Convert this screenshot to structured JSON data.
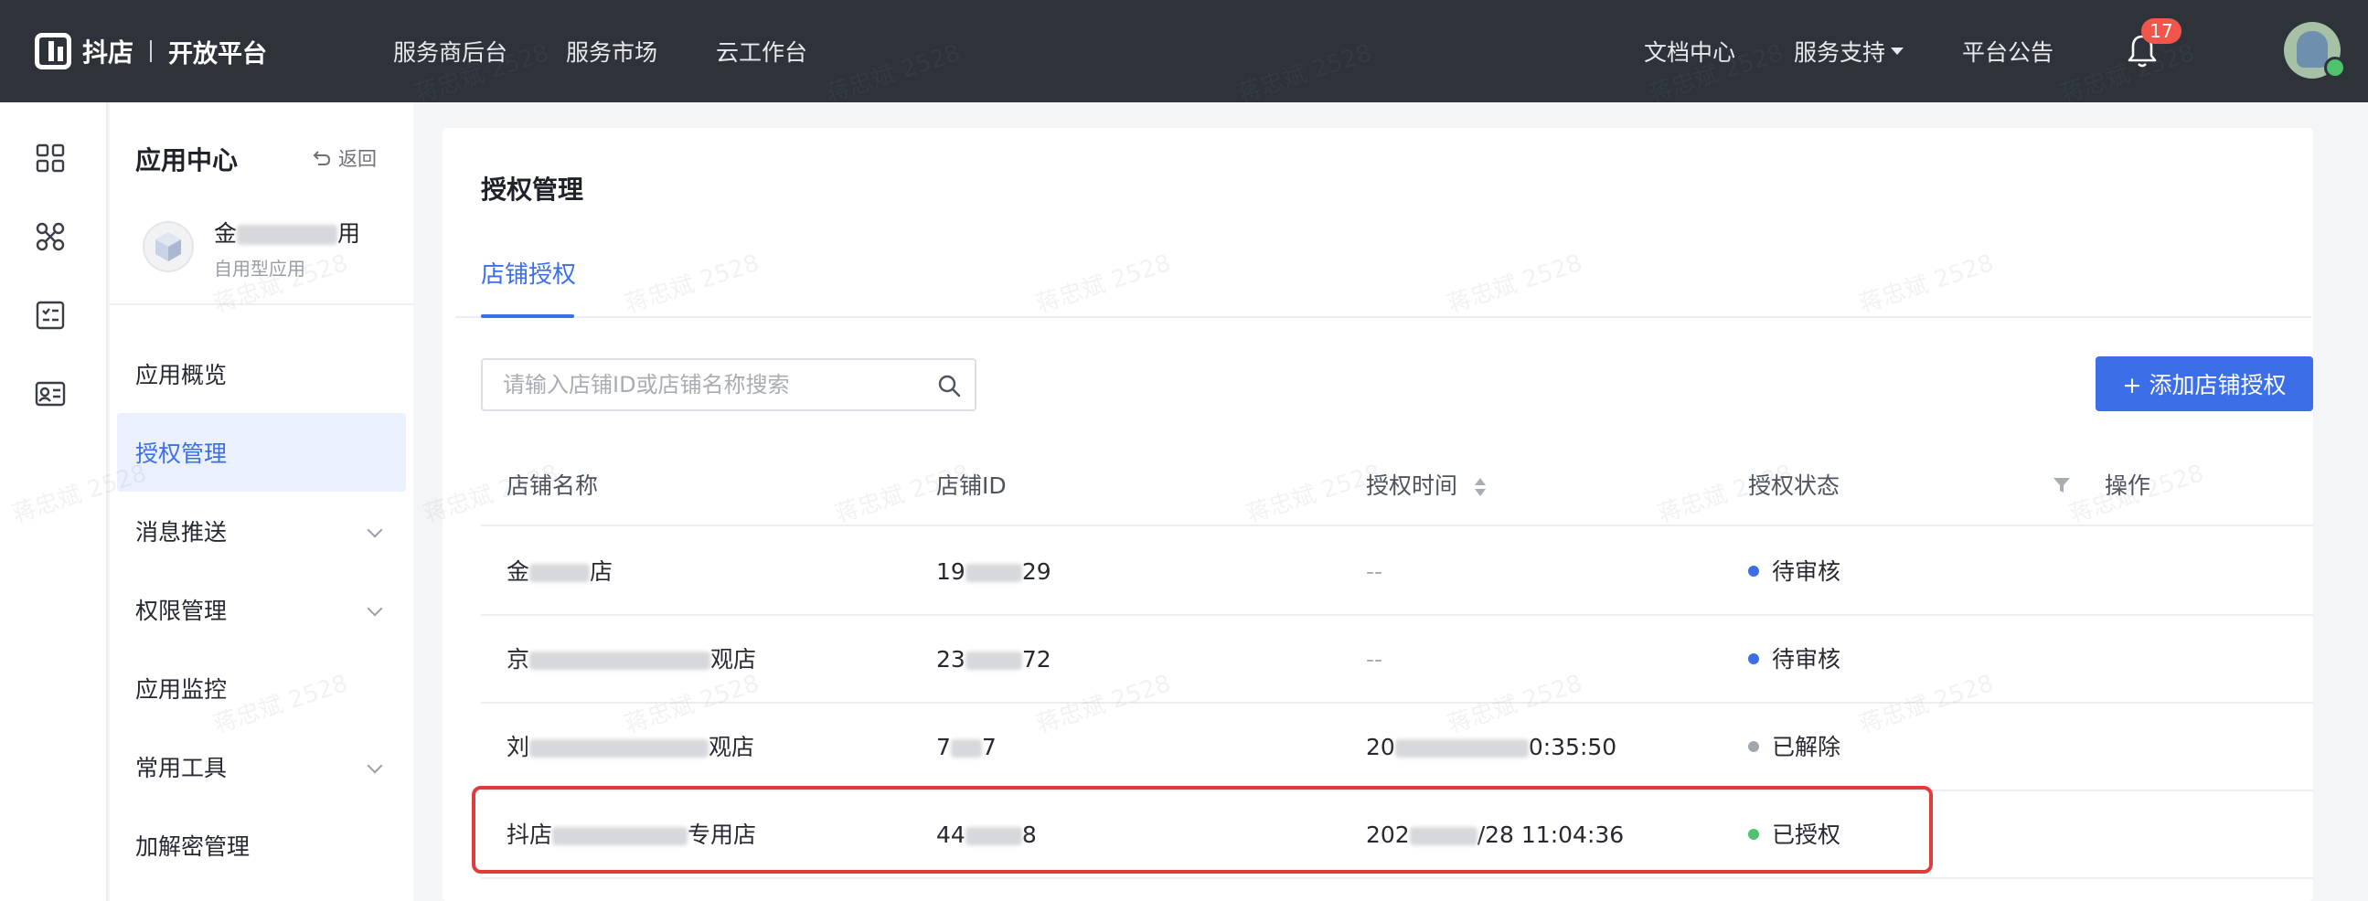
{
  "topbar": {
    "brand": "抖店",
    "brand_sub": "开放平台",
    "nav_left": [
      "服务商后台",
      "服务市场",
      "云工作台"
    ],
    "nav_right": [
      "文档中心",
      "服务支持",
      "平台公告"
    ],
    "notification_count": "17"
  },
  "sidebar": {
    "title": "应用中心",
    "back_label": "返回",
    "app_name_start": "金",
    "app_name_end": "用",
    "app_type": "自用型应用",
    "items": [
      {
        "label": "应用概览",
        "has_children": false,
        "active": false
      },
      {
        "label": "授权管理",
        "has_children": false,
        "active": true
      },
      {
        "label": "消息推送",
        "has_children": true,
        "active": false
      },
      {
        "label": "权限管理",
        "has_children": true,
        "active": false
      },
      {
        "label": "应用监控",
        "has_children": false,
        "active": false
      },
      {
        "label": "常用工具",
        "has_children": true,
        "active": false
      },
      {
        "label": "加解密管理",
        "has_children": false,
        "active": false
      }
    ]
  },
  "main": {
    "title": "授权管理",
    "tabs": [
      {
        "label": "店铺授权",
        "active": true
      }
    ],
    "search": {
      "placeholder": "请输入店铺ID或店铺名称搜索",
      "value": ""
    },
    "add_button_label": "+ 添加店铺授权",
    "table": {
      "columns": [
        "店铺名称",
        "店铺ID",
        "授权时间",
        "授权状态",
        "操作"
      ],
      "rows": [
        {
          "name_a": "金",
          "name_b": "店",
          "id_a": "19",
          "id_b": "29",
          "time_a": "--",
          "time_b": "",
          "status": "待审核",
          "status_color": "#3c6fe7"
        },
        {
          "name_a": "京",
          "name_b": "观店",
          "id_a": "23",
          "id_b": "72",
          "time_a": "--",
          "time_b": "",
          "status": "待审核",
          "status_color": "#3c6fe7"
        },
        {
          "name_a": "刘",
          "name_b": "观店",
          "id_a": "7",
          "id_b": "7",
          "time_a": "20",
          "time_b": "0:35:50",
          "status": "已解除",
          "status_color": "#a2a6ad"
        },
        {
          "name_a": "抖店",
          "name_b": "专用店",
          "id_a": "44",
          "id_b": "8",
          "time_a": "202",
          "time_b": "/28 11:04:36",
          "status": "已授权",
          "status_color": "#4fc26b"
        }
      ]
    }
  },
  "watermark_text": "蒋忠斌 2528",
  "colors": {
    "accent": "#3c6fe7",
    "topbar": "#2e333a",
    "highlight": "#e23b3b"
  }
}
